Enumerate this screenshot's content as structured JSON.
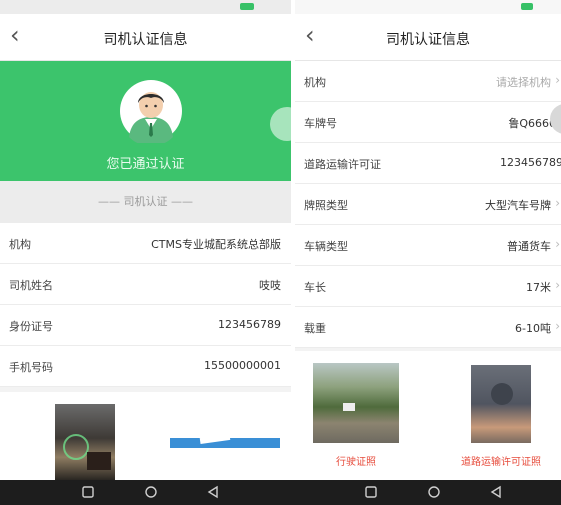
{
  "left": {
    "header_title": "司机认证信息",
    "verified_label": "您已通过认证",
    "section_label": "—— 司机认证 ——",
    "rows": [
      {
        "label": "机构",
        "value": "CTMS专业城配系统总部版"
      },
      {
        "label": "司机姓名",
        "value": "吱吱"
      },
      {
        "label": "身份证号",
        "value": "123456789"
      },
      {
        "label": "手机号码",
        "value": "15500000001"
      }
    ]
  },
  "right": {
    "header_title": "司机认证信息",
    "rows": [
      {
        "label": "机构",
        "value": "请选择机构"
      },
      {
        "label": "车牌号",
        "value": "鲁Q66666"
      },
      {
        "label": "道路运输许可证",
        "value": "123456789"
      },
      {
        "label": "牌照类型",
        "value": "大型汽车号牌"
      },
      {
        "label": "车辆类型",
        "value": "普通货车"
      },
      {
        "label": "车长",
        "value": "17米"
      },
      {
        "label": "载重",
        "value": "6-10吨"
      }
    ],
    "photos": [
      {
        "caption": "行驶证照"
      },
      {
        "caption": "道路运输许可证照"
      }
    ]
  },
  "icons": {
    "back": "chevron-left-icon",
    "avatar": "user-avatar-icon",
    "nav_home": "square-icon",
    "nav_circle": "circle-icon",
    "nav_back": "triangle-back-icon"
  },
  "colors": {
    "accent_green": "#3cc46c",
    "caption_red": "#e74c3c"
  }
}
